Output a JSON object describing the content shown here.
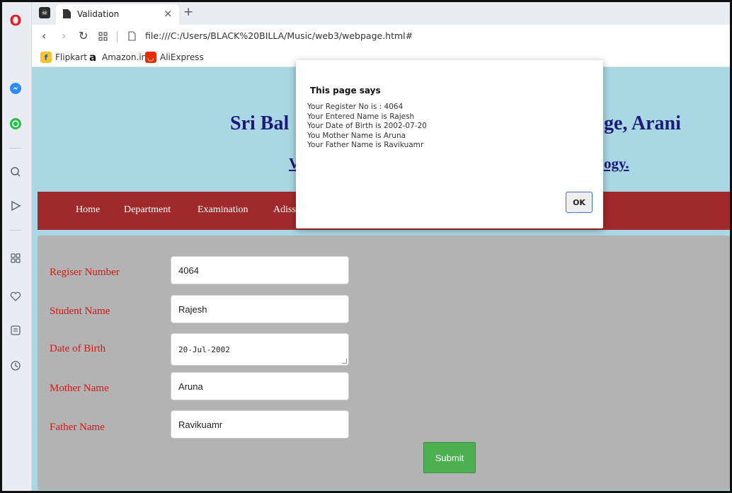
{
  "browser": {
    "tab_title": "Validation",
    "tab_close": "×",
    "new_tab": "+",
    "url": "file:///C:/Users/BLACK%20BILLA/Music/web3/webpage.html#",
    "bookmarks": [
      {
        "label": "Flipkart",
        "icon": "flipkart-icon",
        "color": "#f7c52a"
      },
      {
        "label": "Amazon.in",
        "icon": "amazon-icon",
        "color": "#111111"
      },
      {
        "label": "AliExpress",
        "icon": "aliexpress-icon",
        "color": "#e62e04"
      }
    ]
  },
  "header": {
    "college_left": "Sri Bal",
    "college_right": "ge, Arani",
    "subline_left": "V",
    "subline_right": "ogy."
  },
  "nav": {
    "items": [
      "Home",
      "Department",
      "Examination",
      "Adiss"
    ]
  },
  "form": {
    "fields": [
      {
        "label": "Regiser Number",
        "value": "4064"
      },
      {
        "label": "Student Name",
        "value": "Rajesh"
      },
      {
        "label": "Date of Birth",
        "value": "20-Jul-2002"
      },
      {
        "label": "Mother Name",
        "value": "Aruna"
      },
      {
        "label": "Father Name",
        "value": "Ravikuamr"
      }
    ],
    "submit_label": "Submit"
  },
  "dialog": {
    "title": "This page says",
    "lines": [
      "Your Register No is : 4064",
      "Your Entered Name is Rajesh",
      "Your Date of Birth is 2002-07-20",
      "You Mother Name is Aruna",
      "Your Father Name is Ravikuamr"
    ],
    "ok_label": "OK"
  },
  "colors": {
    "page_bg": "#a9d7e3",
    "navbar": "#a0292b",
    "form_panel": "#b3b3b3",
    "label_red": "#d01818",
    "submit_green": "#4caf50",
    "heading_blue": "#1a1a7a"
  }
}
